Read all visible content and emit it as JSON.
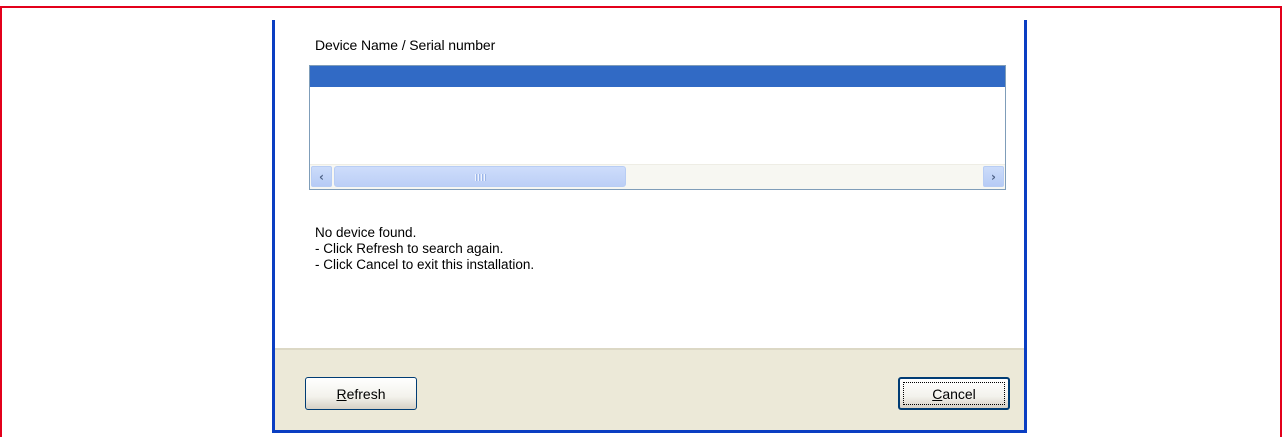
{
  "dialog": {
    "list_heading": "Device Name / Serial number",
    "messages": {
      "line1": "No device found.",
      "line2": "- Click Refresh to search again.",
      "line3": "- Click Cancel to exit this installation."
    },
    "buttons": {
      "refresh": {
        "accel": "R",
        "rest": "efresh"
      },
      "cancel": {
        "accel": "C",
        "rest": "ancel"
      }
    },
    "scrollbar": {
      "left_arrow": "‹",
      "right_arrow": "›"
    }
  },
  "colors": {
    "frame": "#e3001b",
    "dialog_border": "#0a3ec2",
    "selection": "#316ac5",
    "panel": "#ece9d8"
  },
  "icons": [
    "chevron-left-icon",
    "chevron-right-icon"
  ]
}
